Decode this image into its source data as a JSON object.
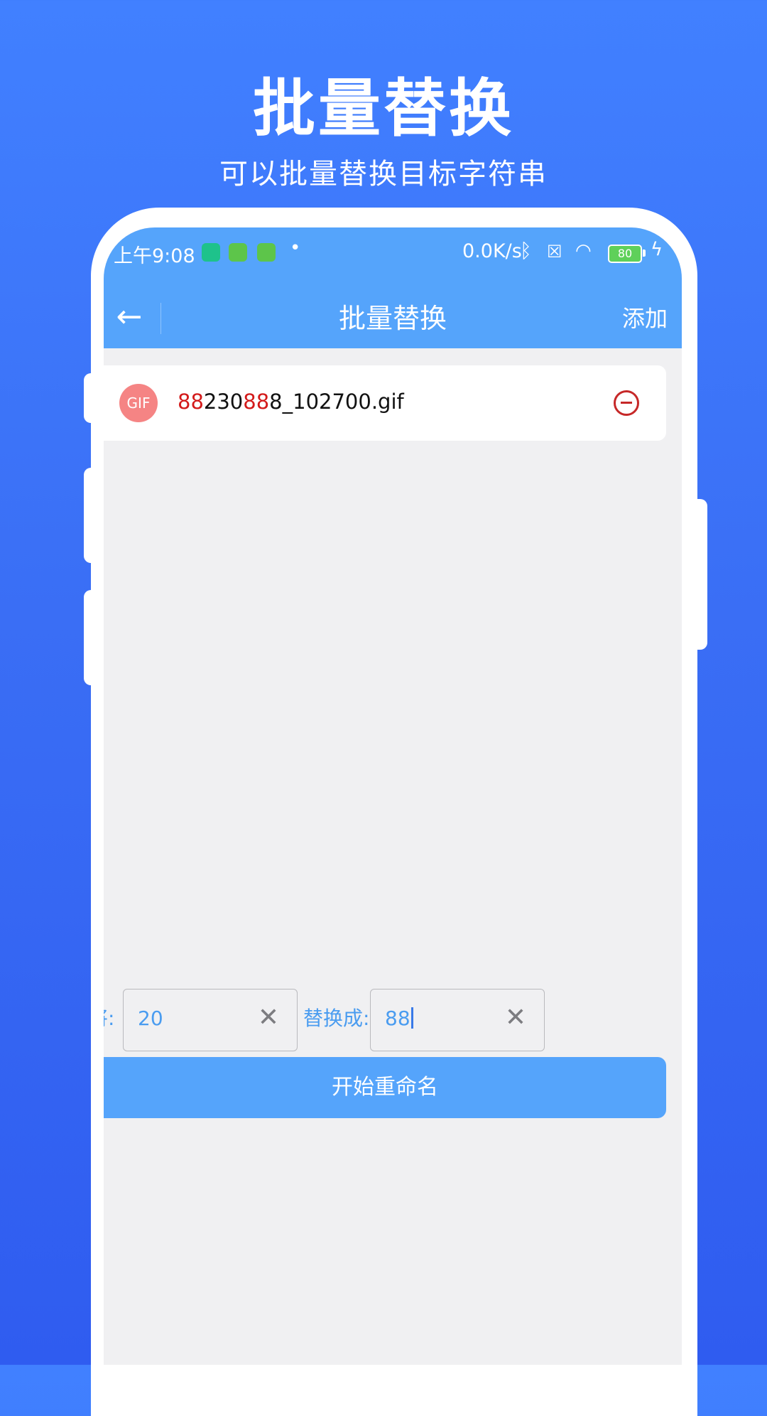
{
  "hero": {
    "title": "批量替换",
    "subtitle": "可以批量替换目标字符串"
  },
  "status_bar": {
    "time": "上午9:08",
    "dot": "•",
    "net_speed": "0.0K/s",
    "battery": "80",
    "icons": [
      "shield-app-icon",
      "android-app-icon",
      "android-app-icon",
      "bluetooth-icon",
      "sim-x-icon",
      "wifi-icon",
      "battery-icon",
      "charging-icon"
    ]
  },
  "app_bar": {
    "back_icon": "←",
    "title": "批量替换",
    "add_label": "添加"
  },
  "files": [
    {
      "badge": "GIF",
      "name_parts": [
        "88",
        "230",
        "88",
        "8_102700.gif"
      ]
    }
  ],
  "replace": {
    "from_label": "将:",
    "from_value": "20",
    "to_label": "替换成:",
    "to_value": "88",
    "clear_glyph": "✕"
  },
  "actions": {
    "start_label": "开始重命名"
  },
  "colors": {
    "background": "#3a6ef5",
    "app_bar": "#55a4fb",
    "highlight": "#d31a1a",
    "accent_text": "#4a9cf0",
    "gif_badge": "#f58484"
  }
}
